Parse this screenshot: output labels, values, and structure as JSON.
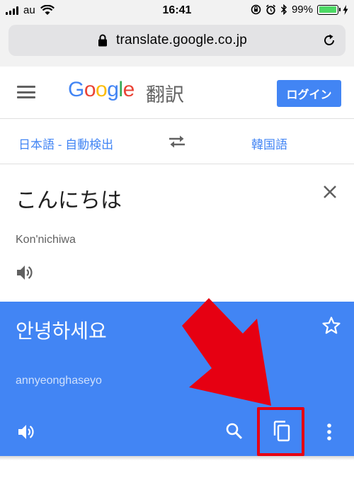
{
  "status_bar": {
    "carrier": "au",
    "time": "16:41",
    "battery": "99%",
    "icons": [
      "signal-icon",
      "wifi-icon",
      "orientation-lock-icon",
      "alarm-icon",
      "bluetooth-icon",
      "battery-icon",
      "charging-icon"
    ],
    "battery_level": 0.99
  },
  "browser": {
    "url": "translate.google.co.jp",
    "icons": [
      "lock-icon",
      "reload-icon"
    ]
  },
  "header": {
    "logo_letters": [
      "G",
      "o",
      "o",
      "g",
      "l",
      "e"
    ],
    "subtitle": "翻訳",
    "login_label": "ログイン",
    "icons": [
      "menu-icon"
    ]
  },
  "languages": {
    "source": "日本語 - 自動検出",
    "target": "韓国語",
    "icons": [
      "swap-icon"
    ]
  },
  "source": {
    "text": "こんにちは",
    "romanization": "Kon'nichiwa",
    "icons": [
      "close-icon",
      "speaker-icon"
    ]
  },
  "result": {
    "text": "안녕하세요",
    "romanization": "annyeonghaseyo",
    "icons": [
      "star-icon",
      "speaker-icon",
      "search-icon",
      "copy-icon",
      "more-vert-icon"
    ]
  },
  "annotation": {
    "icons": [
      "red-arrow-icon",
      "highlight-box"
    ],
    "color": "#e60012"
  },
  "colors": {
    "accent": "#4285f4",
    "annotation_red": "#e60012"
  }
}
